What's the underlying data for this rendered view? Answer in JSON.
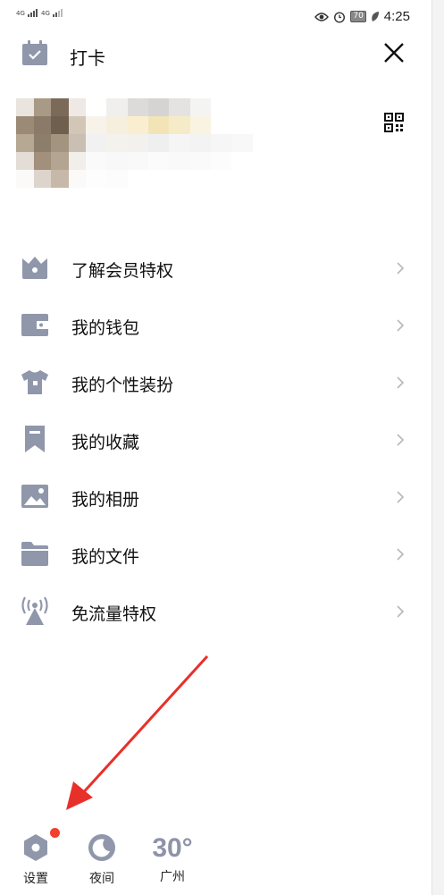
{
  "status_bar": {
    "sim1": "4G",
    "sim2": "4G",
    "battery": "70",
    "time": "4:25"
  },
  "header": {
    "checkin_label": "打卡"
  },
  "menu": {
    "items": [
      {
        "label": "了解会员特权",
        "icon": "crown-icon"
      },
      {
        "label": "我的钱包",
        "icon": "wallet-icon"
      },
      {
        "label": "我的个性装扮",
        "icon": "tshirt-icon"
      },
      {
        "label": "我的收藏",
        "icon": "bookmark-icon"
      },
      {
        "label": "我的相册",
        "icon": "image-icon"
      },
      {
        "label": "我的文件",
        "icon": "folder-icon"
      },
      {
        "label": "免流量特权",
        "icon": "signal-tower-icon"
      }
    ]
  },
  "bottom_bar": {
    "settings_label": "设置",
    "night_label": "夜间",
    "temperature": "30°",
    "city": "广州"
  },
  "colors": {
    "icon_gray": "#9097ab",
    "notification_red": "#f2402f",
    "arrow_red": "#e8302a"
  }
}
